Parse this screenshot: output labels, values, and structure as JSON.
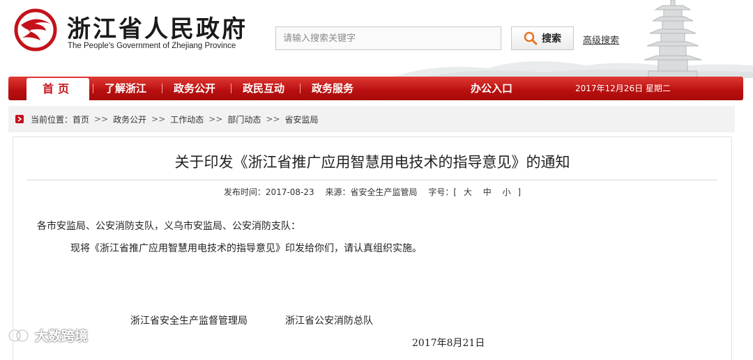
{
  "header": {
    "title": "浙江省人民政府",
    "subtitle": "The People's Government of Zhejiang Province",
    "search_placeholder": "请输入搜索关键字",
    "search_button": "搜索",
    "advanced_search": "高级搜索"
  },
  "nav": {
    "home": "首页",
    "items": [
      "了解浙江",
      "政务公开",
      "政民互动",
      "政务服务"
    ],
    "office": "办公入口",
    "date": "2017年12月26日  星期二"
  },
  "breadcrumb": {
    "prefix": "当前位置：",
    "items": [
      "首页",
      "政务公开",
      "工作动态",
      "部门动态",
      "省安监局"
    ],
    "separator": ">>"
  },
  "article": {
    "title": "关于印发《浙江省推广应用智慧用电技术的指导意见》的通知",
    "publish_time": "发布时间：2017-08-23",
    "source": "来源：省安全生产监管局",
    "font_size_label": "字号：[",
    "size_large": "大",
    "size_medium": "中",
    "size_small": "小",
    "font_size_end": "]",
    "salutation": "各市安监局、公安消防支队，义乌市安监局、公安消防支队：",
    "paragraph": "现将《浙江省推广应用智慧用电技术的指导意见》印发给你们，请认真组织实施。",
    "signer1": "浙江省安全生产监督管理局",
    "signer2": "浙江省公安消防总队",
    "date": "2017年8月21日"
  },
  "watermark": "大数跨境",
  "colors": {
    "brand_red": "#c4121a",
    "nav_gradient_top": "#e03a34",
    "nav_gradient_bottom": "#a80a0a"
  }
}
